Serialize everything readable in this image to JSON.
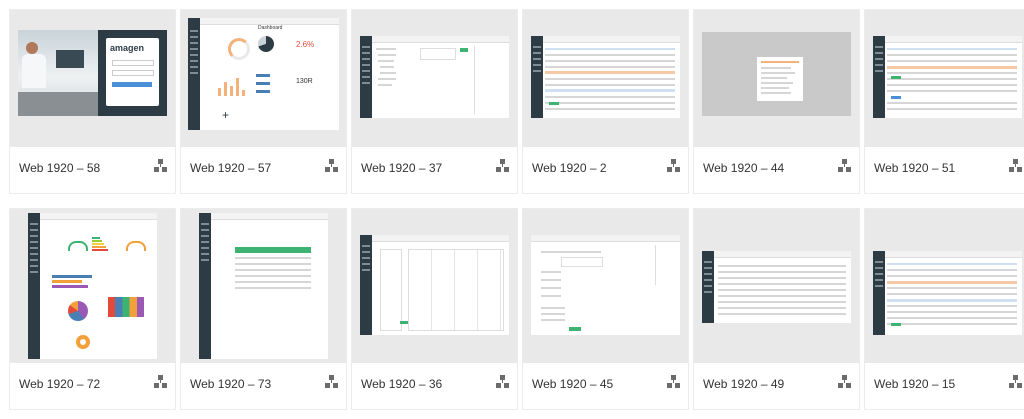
{
  "cards": [
    {
      "label": "Web 1920 – 58",
      "icon": "prototype-icon"
    },
    {
      "label": "Web 1920 – 57",
      "icon": "prototype-icon"
    },
    {
      "label": "Web 1920 – 37",
      "icon": "prototype-icon"
    },
    {
      "label": "Web 1920 – 2",
      "icon": "prototype-icon"
    },
    {
      "label": "Web 1920 – 44",
      "icon": "prototype-icon"
    },
    {
      "label": "Web 1920 – 51",
      "icon": "prototype-icon"
    },
    {
      "label": "Web 1920 – 72",
      "icon": "prototype-icon"
    },
    {
      "label": "Web 1920 – 73",
      "icon": "prototype-icon"
    },
    {
      "label": "Web 1920 – 36",
      "icon": "prototype-icon"
    },
    {
      "label": "Web 1920 – 45",
      "icon": "prototype-icon"
    },
    {
      "label": "Web 1920 – 49",
      "icon": "prototype-icon"
    },
    {
      "label": "Web 1920 – 15",
      "icon": "prototype-icon"
    }
  ],
  "thumbs": {
    "login_logo": "amagen",
    "dashboard_title": "Dashboard",
    "dashboard_metric_a": "2.6%",
    "dashboard_metric_b": "130R",
    "dashboard_plus": "+"
  },
  "colors": {
    "thumb_bg": "#e9e9e9",
    "sidebar": "#2d3b45",
    "login_panel": "#2d3b45",
    "accent_green": "#3cb371",
    "accent_red": "#e24b3b"
  }
}
